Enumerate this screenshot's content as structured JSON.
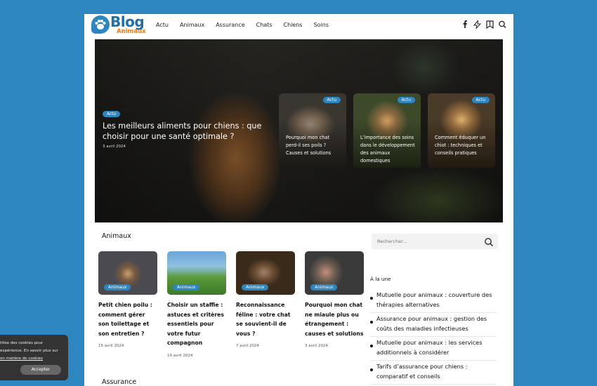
{
  "header": {
    "logo_title": "Blog",
    "logo_subtitle": "Animaux",
    "nav": [
      "Actu",
      "Animaux",
      "Assurance",
      "Chats",
      "Chiens",
      "Soins"
    ],
    "icons": [
      "facebook-icon",
      "bolt-icon",
      "bookmark-icon",
      "search-icon"
    ]
  },
  "hero": {
    "badge": "Actu",
    "title": "Les meilleurs aliments pour chiens : que choisir pour une santé optimale ?",
    "date": "3 avril 2024",
    "minis": [
      {
        "badge": "Actu",
        "title": "Pourquoi mon chat perd-il ses poils ? Causes et solutions"
      },
      {
        "badge": "Actu",
        "title": "L’importance des soins dans le développement des animaux domestiques"
      },
      {
        "badge": "Actu",
        "title": "Comment éduquer un chiot : techniques et conseils pratiques"
      }
    ]
  },
  "animaux": {
    "title": "Animaux",
    "cards": [
      {
        "badge": "Animaux",
        "title": "Petit chien poilu : comment gérer son toilettage et son entretien ?",
        "date": "15 avril 2024"
      },
      {
        "badge": "Animaux",
        "title": "Choisir un staffie : astuces et critères essentiels pour votre futur compagnon",
        "date": "10 avril 2024"
      },
      {
        "badge": "Animaux",
        "title": "Reconnaissance féline : votre chat se souvient-il de vous ?",
        "date": "7 avril 2024"
      },
      {
        "badge": "Animaux",
        "title": "Pourquoi mon chat ne miaule plus ou étrangement : causes et solutions",
        "date": "3 avril 2024"
      }
    ]
  },
  "sidebar": {
    "search_placeholder": "Rechercher...",
    "une_title": "À la une",
    "une_items": [
      "Mutuelle pour animaux : couverture des thérapies alternatives",
      "Assurance pour animaux : gestion des coûts des maladies infectieuses",
      "Mutuelle pour animaux : les services additionnels à considérer",
      "Tarifs d’assurance pour chiens : comparatif et conseils"
    ]
  },
  "assurance": {
    "title": "Assurance"
  },
  "cookie": {
    "line1": "tilise des cookies pour",
    "line2": "expérience. En savoir plus sur",
    "link": "on matière de cookies",
    "accept": "Accepter"
  }
}
